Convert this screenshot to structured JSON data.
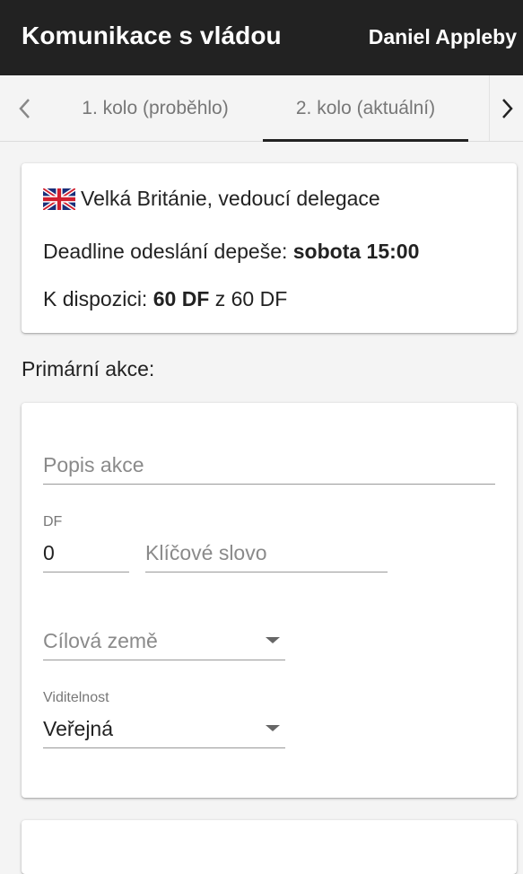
{
  "appbar": {
    "title": "Komunikace s vládou",
    "user": "Daniel Appleby"
  },
  "tabs": {
    "prev_icon": "chevron-left-icon",
    "next_icon": "chevron-right-icon",
    "items": [
      {
        "label": "1. kolo (proběhlo)",
        "active": false
      },
      {
        "label": "2. kolo (aktuální)",
        "active": true
      }
    ]
  },
  "info": {
    "flag_icon": "uk-flag-icon",
    "country_line": "Velká Británie, vedoucí delegace",
    "deadline_prefix": "Deadline odeslání depeše: ",
    "deadline_value": "sobota 15:00",
    "available_prefix": "K dispozici: ",
    "available_value": "60 DF",
    "available_suffix": " z 60 DF"
  },
  "primary": {
    "section_label": "Primární akce:",
    "description_placeholder": "Popis akce",
    "df_label": "DF",
    "df_value": "0",
    "keyword_placeholder": "Klíčové slovo",
    "target_placeholder": "Cílová země",
    "visibility_label": "Viditelnost",
    "visibility_value": "Veřejná"
  },
  "colors": {
    "appbar_bg": "#222222",
    "page_bg": "#f4f4f4",
    "tab_indicator": "#222222"
  }
}
